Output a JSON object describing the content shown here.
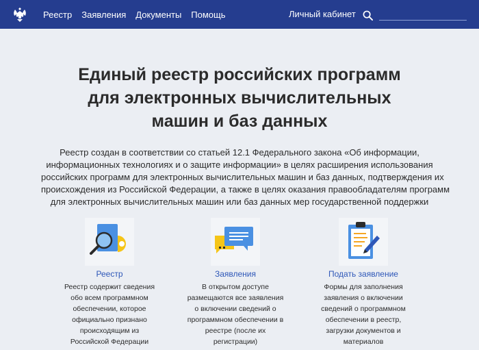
{
  "header": {
    "nav": [
      {
        "label": "Реестр"
      },
      {
        "label": "Заявления"
      },
      {
        "label": "Документы"
      },
      {
        "label": "Помощь"
      }
    ],
    "cabinet_label": "Личный кабинет",
    "search_placeholder": "",
    "brand_color": "#253d8f"
  },
  "hero": {
    "title_lines": [
      "Единый реестр российских программ",
      "для электронных вычислительных",
      "машин и баз данных"
    ],
    "description_lines": [
      "Реестр создан в соответствии со статьей 12.1 Федерального закона «Об информации,",
      "информационных технологиях и о защите информации» в целях расширения использования",
      "российских программ для электронных вычислительных машин и баз данных, подтверждения их",
      "происхождения из Российской Федерации, а также в целях оказания правообладателям программ",
      "для электронных вычислительных машин или баз данных мер государственной поддержки"
    ]
  },
  "cards": [
    {
      "icon": "magnifier-document-icon",
      "title": "Реестр",
      "lines": [
        "Реестр содержит сведения",
        "обо всем программном",
        "обеспечении, которое",
        "официально признано",
        "происходящим из",
        "Российской Федерации"
      ]
    },
    {
      "icon": "chat-bubbles-icon",
      "title": "Заявления",
      "lines": [
        "В открытом доступе",
        "размещаются все заявления",
        "о включении сведений о",
        "программном обеспечении в",
        "реестре (после их",
        "регистрации)"
      ]
    },
    {
      "icon": "clipboard-pen-icon",
      "title": "Подать заявление",
      "lines": [
        "Формы для заполнения",
        "заявления о включении",
        "сведений о программном",
        "обеспечении в реестр,",
        "загрузки документов и",
        "материалов"
      ]
    }
  ]
}
